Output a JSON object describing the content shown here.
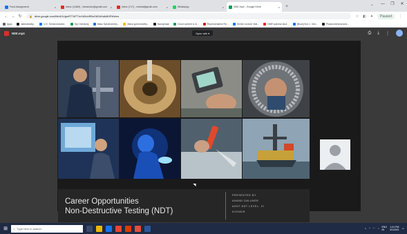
{
  "browser": {
    "tabs": [
      {
        "label": "Fund Assignment",
        "color": "#1a73e8",
        "active": false
      },
      {
        "label": "Inbox (3,869) - himanshu@gmail.com",
        "color": "#d93025",
        "active": false
      },
      {
        "label": "Inbox (717) - mishal@gmail.com",
        "color": "#d93025",
        "active": false
      },
      {
        "label": "WhatsApp",
        "color": "#25d366",
        "active": false
      },
      {
        "label": "NDE.mp4 - Google Drive",
        "color": "#0f9d58",
        "active": true
      }
    ],
    "new_tab": "+",
    "url": "drive.google.com/file/d/1UgmRT7dFT1nXkDuhRBuG8GdXwlk8HRil/view",
    "profile_status": "Paused",
    "bookmarks": [
      {
        "label": "Apps",
        "color": "#5f6368"
      },
      {
        "label": "matmatically...",
        "color": "#202124"
      },
      {
        "label": "U.S. Semiconductor...",
        "color": "#1a73e8"
      },
      {
        "label": "My Chemistry",
        "color": "#0f9d58"
      },
      {
        "label": "Mass Spectrometry...",
        "color": "#1a73e8"
      },
      {
        "label": "Mass spectrometry...",
        "color": "#fbbc04"
      },
      {
        "label": "Nanophase",
        "color": "#202124"
      },
      {
        "label": "Cloud content & m...",
        "color": "#0f9d58"
      },
      {
        "label": "Representative Re...",
        "color": "#c5221f"
      },
      {
        "label": "Online Lecture Vide...",
        "color": "#1a73e8"
      },
      {
        "label": "NMR spectral stud...",
        "color": "#d93025"
      },
      {
        "label": "[Book] Nor 1: One...",
        "color": "#1a73e8"
      },
      {
        "label": "Physiochemical and...",
        "color": "#202124"
      }
    ]
  },
  "viewer": {
    "file_name": "NDE.mp4",
    "open_with": "Open with ▾"
  },
  "slide": {
    "title_line1": "Career Opportunities",
    "title_line2": "Non-Destructive Testing (NDT)",
    "presenter": [
      "PRESENTED BY",
      "ANAND DALUNDE",
      "ASNT NDT LEVEL- III",
      "KCENDR"
    ]
  },
  "taskbar": {
    "search_placeholder": "Type here to search",
    "clock_time": "1:41 PM",
    "clock_date": "3/1/2021",
    "lang": "ENG\nIN"
  },
  "colors": {
    "viewer_bg": "#3a3a3a",
    "taskbar_bg": "#1f2a44"
  }
}
